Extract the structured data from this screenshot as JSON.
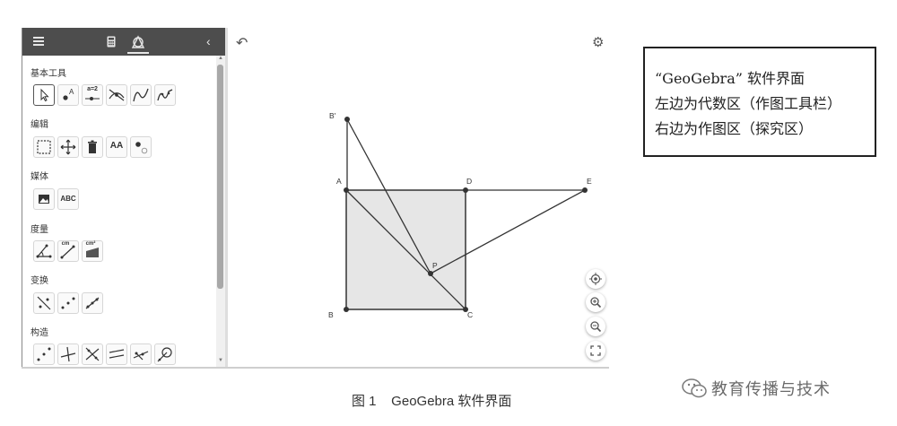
{
  "toolbar": {
    "tab_algebra": "algebra-calculator-tab",
    "tab_tools": "tools-tab",
    "categories": [
      {
        "label": "基本工具"
      },
      {
        "label": "编辑"
      },
      {
        "label": "媒体"
      },
      {
        "label": "度量"
      },
      {
        "label": "变换"
      },
      {
        "label": "构造"
      }
    ],
    "tool_texts": {
      "input_box": "a=2",
      "text": "ABC",
      "text_style": "AA",
      "distance": "cm",
      "area": "cm²"
    }
  },
  "graphics": {
    "points": {
      "B_prime": "B'",
      "A": "A",
      "D": "D",
      "E": "E",
      "P": "P",
      "B": "B",
      "C": "C"
    }
  },
  "annotation": {
    "line1": "“GeoGebra” 软件界面",
    "line2": "左边为代数区（作图工具栏）",
    "line3": "右边为作图区（探究区）"
  },
  "caption": "图 1    GeoGebra 软件界面",
  "watermark": "教育传播与技术",
  "colors": {
    "header": "#4d4d4d",
    "square_fill": "#e6e6e6",
    "line": "#333333",
    "border": "#222222"
  }
}
